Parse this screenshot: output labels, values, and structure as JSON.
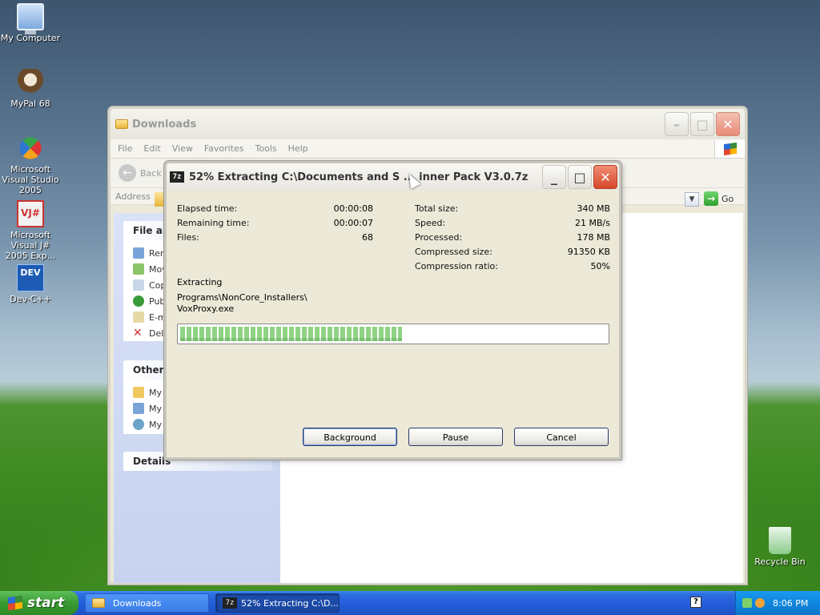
{
  "desktop": {
    "icons": [
      {
        "label": "My Computer"
      },
      {
        "label": "MyPal 68"
      },
      {
        "label": "Microsoft Visual Studio 2005"
      },
      {
        "label": "Microsoft Visual J# 2005 Exp..."
      },
      {
        "label": "Dev-C++"
      },
      {
        "label": "Recycle Bin"
      }
    ],
    "vj_badge": "VJ#",
    "dev_badge": "DEV"
  },
  "explorer": {
    "title": "Downloads",
    "menu": [
      "File",
      "Edit",
      "View",
      "Favorites",
      "Tools",
      "Help"
    ],
    "back_label": "Back",
    "address_label": "Address",
    "go_label": "Go",
    "file_tasks": {
      "title": "File and",
      "items": [
        "Ren",
        "Mov",
        "Cop",
        "Pub",
        "E-m",
        "Dele"
      ]
    },
    "other_places": {
      "title": "Other P",
      "items": [
        "My",
        "My",
        "My"
      ]
    },
    "details_title": "Details"
  },
  "dialog": {
    "title": "52% Extracting C:\\Documents and S ... inner Pack V3.0.7z",
    "stats_left": [
      {
        "label": "Elapsed time:",
        "value": "00:00:08"
      },
      {
        "label": "Remaining time:",
        "value": "00:00:07"
      },
      {
        "label": "Files:",
        "value": "68"
      }
    ],
    "stats_right": [
      {
        "label": "Total size:",
        "value": "340 MB"
      },
      {
        "label": "Speed:",
        "value": "21 MB/s"
      },
      {
        "label": "Processed:",
        "value": "178 MB"
      },
      {
        "label": "Compressed size:",
        "value": "91350 KB"
      },
      {
        "label": "Compression ratio:",
        "value": "50%"
      }
    ],
    "operation": "Extracting",
    "current_path": "Programs\\NonCore_Installers\\",
    "current_file": "VoxProxy.exe",
    "progress_fraction": 0.52,
    "buttons": {
      "background": "Background",
      "pause": "Pause",
      "cancel": "Cancel"
    }
  },
  "taskbar": {
    "start_label": "start",
    "tasks": [
      {
        "label": "Downloads"
      },
      {
        "label": "52% Extracting C:\\D..."
      }
    ],
    "clock": "8:06 PM"
  }
}
